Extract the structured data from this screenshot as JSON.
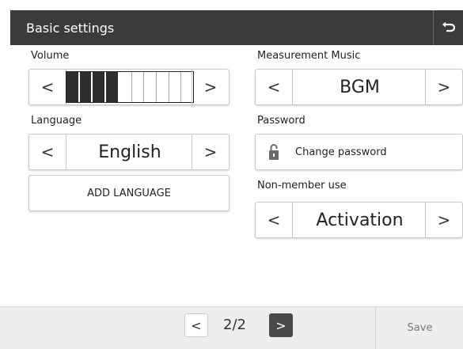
{
  "header": {
    "title": "Basic settings",
    "back_icon": "return-arrow-icon"
  },
  "volume": {
    "label": "Volume",
    "level": 4,
    "max": 10
  },
  "language": {
    "label": "Language",
    "value": "English"
  },
  "add_language": {
    "label": "ADD LANGUAGE"
  },
  "music": {
    "label": "Measurement Music",
    "value": "BGM"
  },
  "password": {
    "label": "Password",
    "button": "Change password",
    "icon": "lock-icon"
  },
  "nonmember": {
    "label": "Non-member use",
    "value": "Activation"
  },
  "footer": {
    "page": "2/2",
    "save": "Save"
  },
  "arrows": {
    "prev": "<",
    "next": ">"
  }
}
